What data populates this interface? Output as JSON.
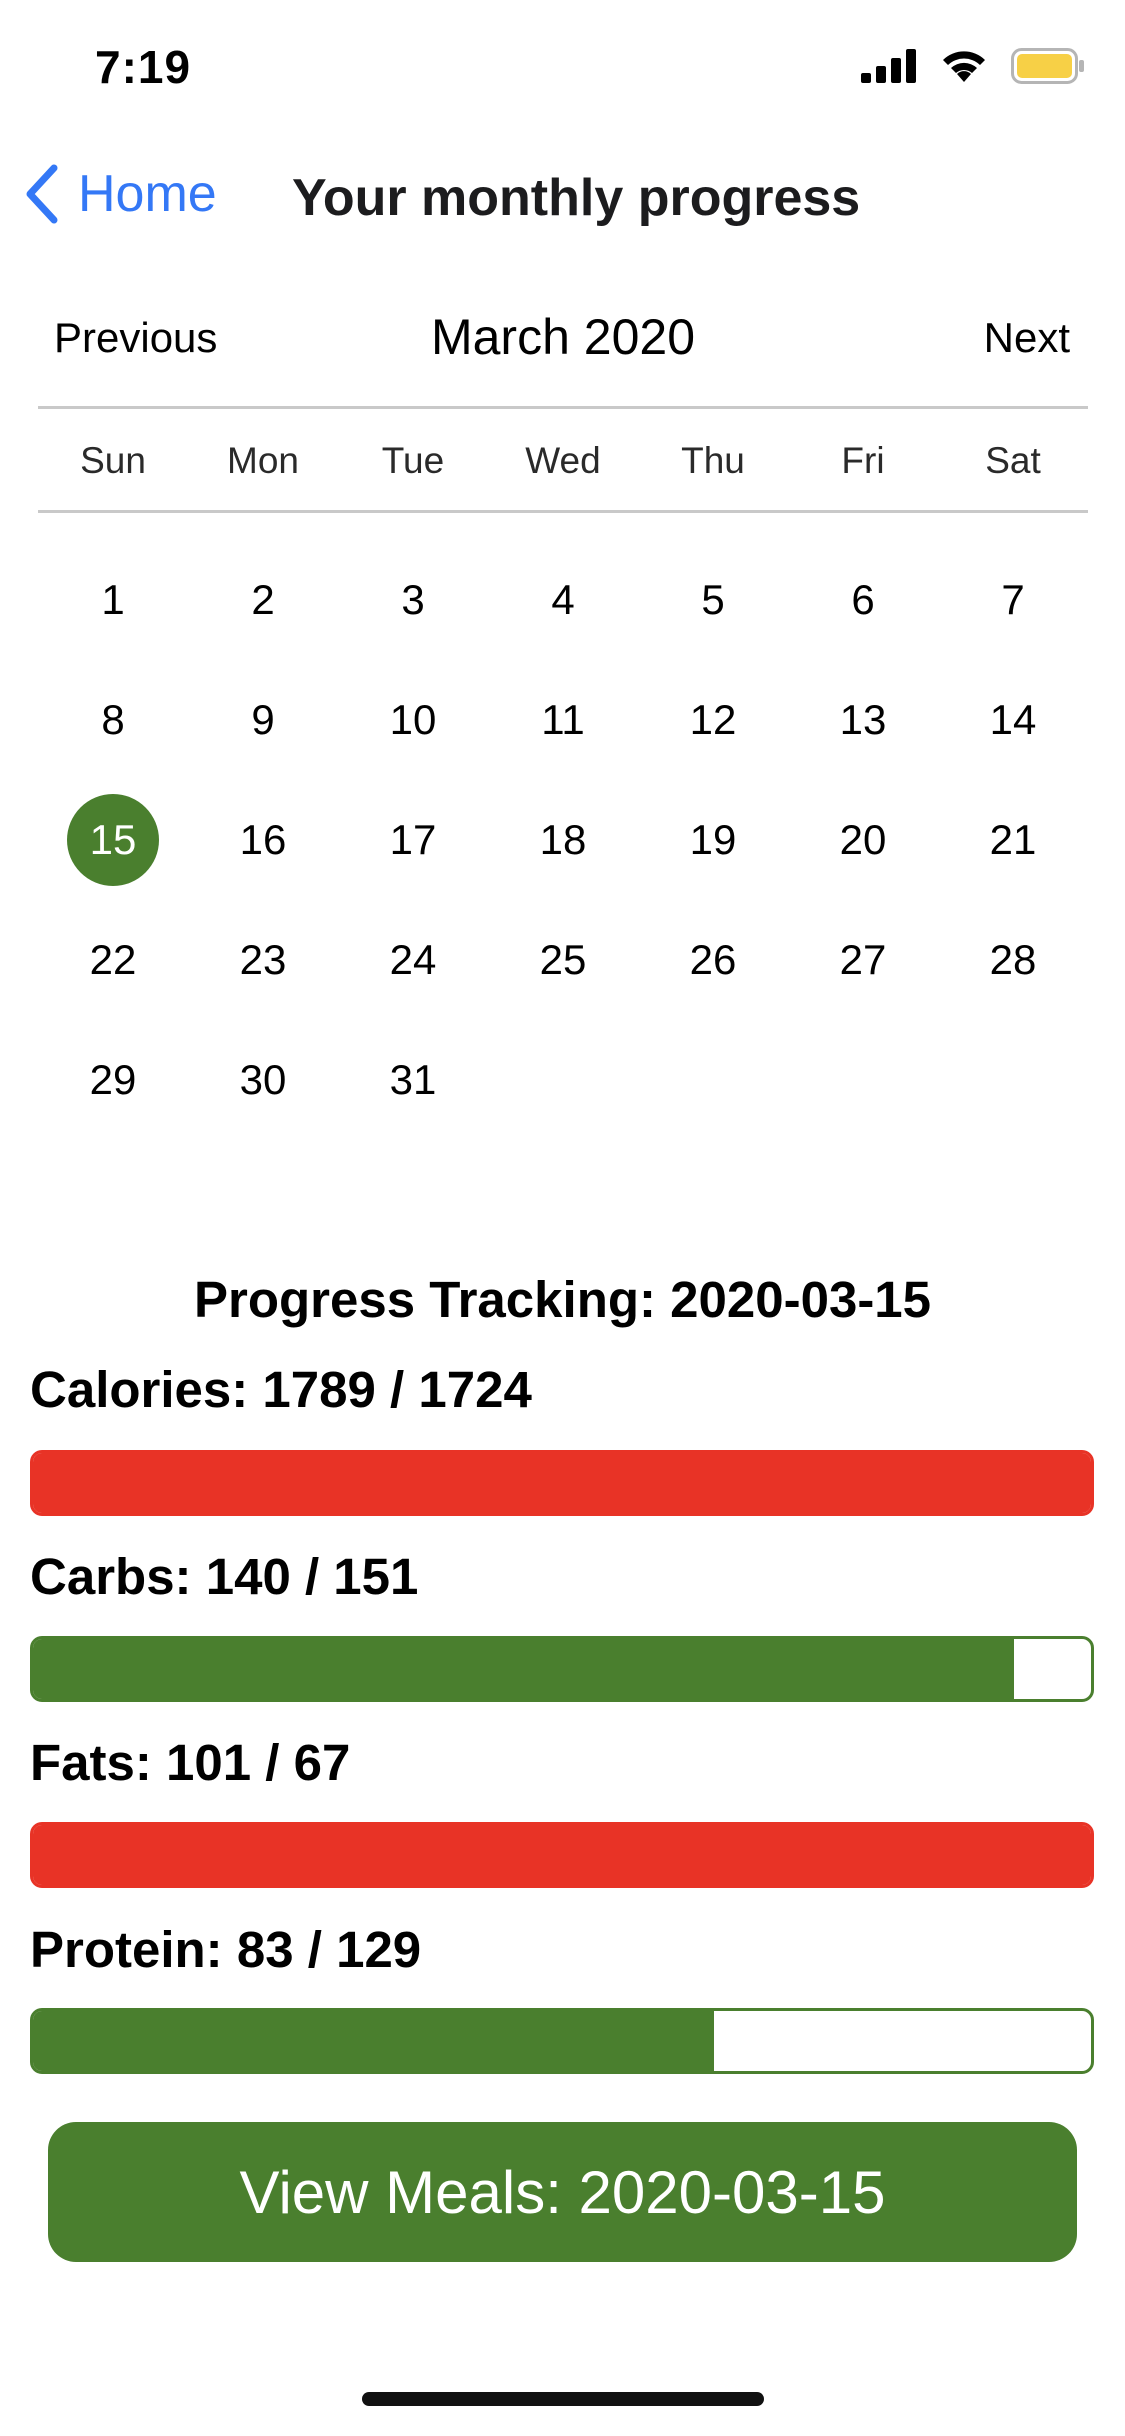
{
  "status_bar": {
    "time": "7:19",
    "signal_icon": "cellular-signal-icon",
    "wifi_icon": "wifi-icon",
    "battery_icon": "battery-icon",
    "battery_color": "#f7d046"
  },
  "nav": {
    "back_label": "Home",
    "back_icon": "chevron-left-icon",
    "title": "Your monthly progress",
    "accent": "#3478f6"
  },
  "calendar": {
    "prev_label": "Previous",
    "next_label": "Next",
    "month_label": "March 2020",
    "weekdays": [
      "Sun",
      "Mon",
      "Tue",
      "Wed",
      "Thu",
      "Fri",
      "Sat"
    ],
    "days": [
      "1",
      "2",
      "3",
      "4",
      "5",
      "6",
      "7",
      "8",
      "9",
      "10",
      "11",
      "12",
      "13",
      "14",
      "15",
      "16",
      "17",
      "18",
      "19",
      "20",
      "21",
      "22",
      "23",
      "24",
      "25",
      "26",
      "27",
      "28",
      "29",
      "30",
      "31"
    ],
    "selected_day": "15",
    "selected_color": "#4a7f2e"
  },
  "progress": {
    "title": "Progress Tracking: 2020-03-15",
    "metrics": [
      {
        "label": "Calories: 1789 / 1724",
        "value": 1789,
        "target": 1724,
        "over": true
      },
      {
        "label": "Carbs: 140 / 151",
        "value": 140,
        "target": 151,
        "over": false
      },
      {
        "label": "Fats: 101 / 67",
        "value": 101,
        "target": 67,
        "over": true
      },
      {
        "label": "Protein: 83 / 129",
        "value": 83,
        "target": 129,
        "over": false
      }
    ],
    "ok_color": "#4a7f2e",
    "over_color": "#e83326"
  },
  "view_meals_label": "View Meals: 2020-03-15"
}
